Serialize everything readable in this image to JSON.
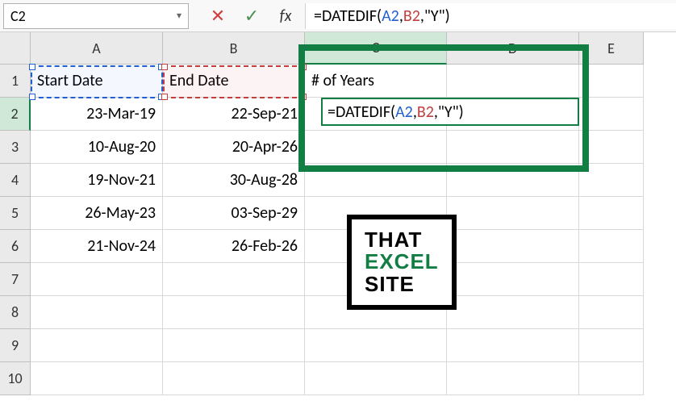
{
  "nameBox": {
    "value": "C2"
  },
  "formulaBar": {
    "prefix": "=DATEDIF(",
    "ref1": "A2",
    "sep1": ",",
    "ref2": "B2",
    "suffix": ",\"Y\")"
  },
  "columns": [
    "A",
    "B",
    "C",
    "D",
    "E"
  ],
  "activeColIndex": 2,
  "rows": [
    "1",
    "2",
    "3",
    "4",
    "5",
    "6",
    "7",
    "8",
    "9",
    "10"
  ],
  "activeRowIndex": 1,
  "headerRow": {
    "A": "Start Date",
    "B": "End Date",
    "C": "# of Years"
  },
  "dataRows": [
    {
      "A": "23-Mar-19",
      "B": "22-Sep-21"
    },
    {
      "A": "10-Aug-20",
      "B": "20-Apr-26"
    },
    {
      "A": "19-Nov-21",
      "B": "30-Aug-28"
    },
    {
      "A": "26-May-23",
      "B": "03-Sep-29"
    },
    {
      "A": "21-Nov-24",
      "B": "26-Feb-26"
    }
  ],
  "editCell": {
    "prefix": "=DATEDIF(",
    "ref1": "A2",
    "sep1": ",",
    "ref2": "B2",
    "suffix": ",\"Y\")"
  },
  "logo": {
    "line1": "THAT",
    "line2": "EXCEL",
    "line3": "SITE"
  }
}
